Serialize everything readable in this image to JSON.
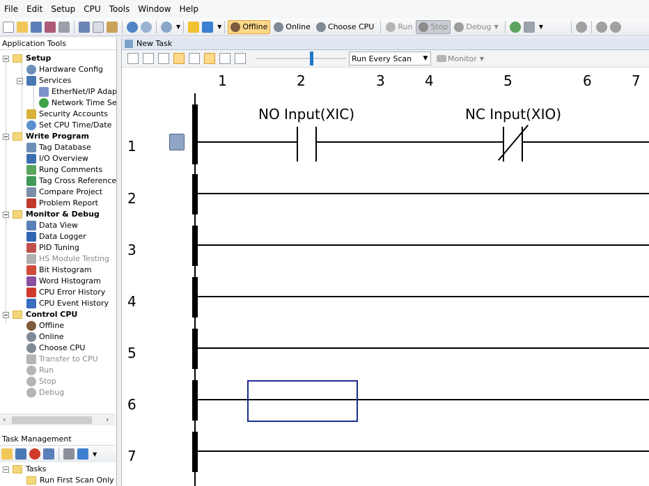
{
  "menu": [
    "File",
    "Edit",
    "Setup",
    "CPU",
    "Tools",
    "Window",
    "Help"
  ],
  "toolbar": {
    "offline": "Offline",
    "online": "Online",
    "choose_cpu": "Choose CPU",
    "run": "Run",
    "stop": "Stop",
    "debug": "Debug"
  },
  "app_tools": {
    "title": "Application Tools",
    "setup": "Setup",
    "hardware_config": "Hardware Config",
    "services": "Services",
    "ethernet": "EtherNet/IP Adapt",
    "ntp": "Network Time Serv",
    "security": "Security Accounts",
    "set_time": "Set CPU Time/Date",
    "write_program": "Write Program",
    "tag_db": "Tag Database",
    "io_overview": "I/O Overview",
    "rung_comments": "Rung Comments",
    "tag_xref": "Tag Cross Reference",
    "compare": "Compare Project",
    "problem": "Problem Report",
    "monitor_debug": "Monitor & Debug",
    "data_view": "Data View",
    "data_logger": "Data Logger",
    "pid": "PID Tuning",
    "hs_module": "HS Module Testing",
    "bit_hist": "Bit Histogram",
    "word_hist": "Word Histogram",
    "cpu_error": "CPU Error History",
    "cpu_event": "CPU Event History",
    "control_cpu": "Control CPU",
    "offline": "Offline",
    "online": "Online",
    "choose_cpu": "Choose CPU",
    "transfer": "Transfer to CPU",
    "run": "Run",
    "stop": "Stop",
    "debug": "Debug"
  },
  "task_mgmt": {
    "title": "Task Management",
    "tasks": "Tasks",
    "run_first": "Run First Scan Only"
  },
  "editor": {
    "title": "New Task",
    "scan_mode": "Run Every Scan",
    "monitor": "Monitor",
    "columns": [
      "1",
      "2",
      "3",
      "4",
      "5",
      "6",
      "7"
    ],
    "rungs": [
      "1",
      "2",
      "3",
      "4",
      "5",
      "6",
      "7"
    ],
    "no_input_label": "NO Input(XIC)",
    "nc_input_label": "NC Input(XIO)"
  },
  "colors": {
    "active_button": "#ffd98a",
    "selection_border": "#1c2b8f",
    "slider": "#1e78c8"
  }
}
